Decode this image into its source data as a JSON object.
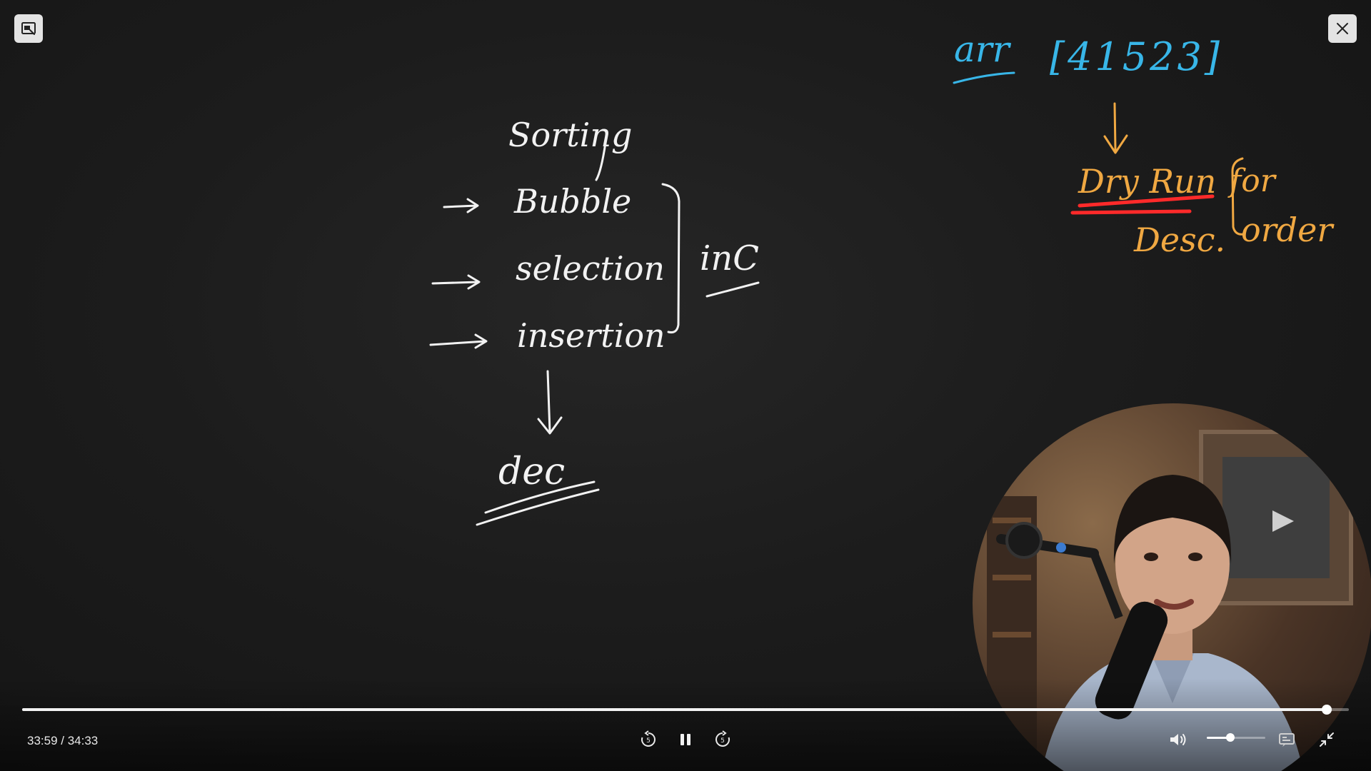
{
  "player": {
    "current_time": "33:59",
    "separator": " / ",
    "duration": "34:33",
    "progress_fraction": 0.9835,
    "volume_fraction": 0.4
  },
  "board": {
    "title_word": "Sorting",
    "items": [
      "Bubble",
      "selection",
      "insertion"
    ],
    "brace_label": "inC",
    "result_label": "dec",
    "array_name": "arr",
    "array_values": "[41523]",
    "dry_run_label": "Dry Run",
    "for_label": "for",
    "desc_label": "Desc.",
    "order_label": "order"
  },
  "icons": {
    "mini_player": "mini-player-icon",
    "close": "close-icon",
    "rewind": "rewind-5-icon",
    "pause": "pause-icon",
    "forward": "forward-5-icon",
    "volume": "volume-icon",
    "captions": "captions-icon",
    "exit_fullscreen": "exit-fullscreen-icon"
  },
  "colors": {
    "chalk_white": "#f2f2f2",
    "chalk_blue": "#38b6e8",
    "chalk_orange": "#f0a842",
    "highlight_red": "#ff2a2a"
  }
}
